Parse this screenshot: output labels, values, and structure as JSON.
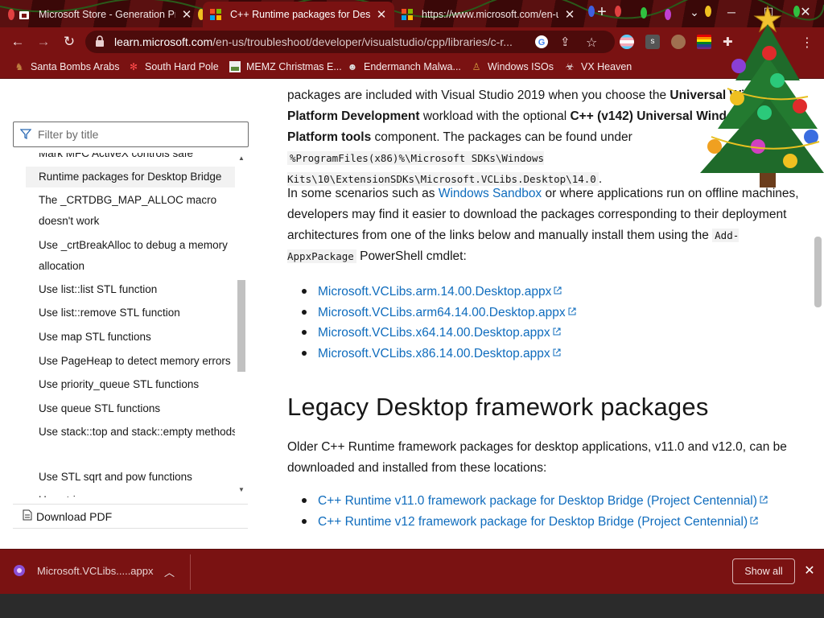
{
  "tabs": [
    {
      "label": "Microsoft Store - Generation Project",
      "icon": "store-icon",
      "active": false
    },
    {
      "label": "C++ Runtime packages for Desktop Bridge",
      "icon": "microsoft-icon",
      "active": true
    },
    {
      "label": "https://www.microsoft.com/en-us",
      "icon": "microsoft-icon",
      "active": false
    }
  ],
  "toolbar": {
    "url_host": "learn.microsoft.com",
    "url_path": "/en-us/troubleshoot/developer/visualstudio/cpp/libraries/c-r..."
  },
  "bookmarks": [
    {
      "label": "Santa Bombs Arabs",
      "icon": "reindeer-icon"
    },
    {
      "label": "South Hard Pole",
      "icon": "snowflake-icon"
    },
    {
      "label": "MEMZ Christmas E...",
      "icon": "image-icon"
    },
    {
      "label": "Endermanch Malwa...",
      "icon": "raccoon-icon"
    },
    {
      "label": "Windows ISOs",
      "icon": "gnome-icon"
    },
    {
      "label": "VX Heaven",
      "icon": "biohazard-icon"
    }
  ],
  "sidebar": {
    "filter_placeholder": "Filter by title",
    "items": [
      {
        "label": "Mark MFC ActiveX controls safe"
      },
      {
        "label": "Runtime packages for Desktop Bridge",
        "active": true
      },
      {
        "label": "The _CRTDBG_MAP_ALLOC macro doesn't work"
      },
      {
        "label": "Use _crtBreakAlloc to debug a memory allocation"
      },
      {
        "label": "Use list::list STL function"
      },
      {
        "label": "Use list::remove STL function"
      },
      {
        "label": "Use map STL functions"
      },
      {
        "label": "Use PageHeap to detect memory errors"
      },
      {
        "label": "Use priority_queue STL functions"
      },
      {
        "label": "Use queue STL functions"
      },
      {
        "label": "Use stack::top and stack::empty methods"
      },
      {
        "label": "Use STL sqrt and pow functions"
      },
      {
        "label": "Use string arrays"
      }
    ],
    "download_pdf": "Download PDF"
  },
  "content": {
    "p1_a": "packages are included with Visual Studio 2019 when you choose the ",
    "p1_b": "Universal Windows Platform Development",
    "p1_c": " workload with the optional ",
    "p1_d": "C++ (v142) Universal Windows Platform tools",
    "p1_e": " component. The packages can be found under ",
    "p1_code": "%ProgramFiles(x86)%\\Microsoft SDKs\\Windows Kits\\10\\ExtensionSDKs\\Microsoft.VCLibs.Desktop\\14.0",
    "p1_f": ".",
    "p2_a": "In some scenarios such as ",
    "p2_link": "Windows Sandbox",
    "p2_b": " or where applications run on offline machines, developers may find it easier to download the packages corresponding to their deployment architectures from one of the links below and manually install them using the ",
    "p2_code": "Add-AppxPackage",
    "p2_c": " PowerShell cmdlet:",
    "links": [
      "Microsoft.VCLibs.arm.14.00.Desktop.appx",
      "Microsoft.VCLibs.arm64.14.00.Desktop.appx",
      "Microsoft.VCLibs.x64.14.00.Desktop.appx",
      "Microsoft.VCLibs.x86.14.00.Desktop.appx"
    ],
    "heading": "Legacy Desktop framework packages",
    "p3": "Older C++ Runtime framework packages for desktop applications, v11.0 and v12.0, can be downloaded and installed from these locations:",
    "legacy_links": [
      "C++ Runtime v11.0 framework package for Desktop Bridge (Project Centennial)",
      "C++ Runtime v12 framework package for Desktop Bridge (Project Centennial)"
    ]
  },
  "download_bar": {
    "filename": "Microsoft.VCLibs.....appx",
    "show_all": "Show all"
  },
  "colors": {
    "theme": "#7a1212",
    "link": "#0f6cbd"
  }
}
